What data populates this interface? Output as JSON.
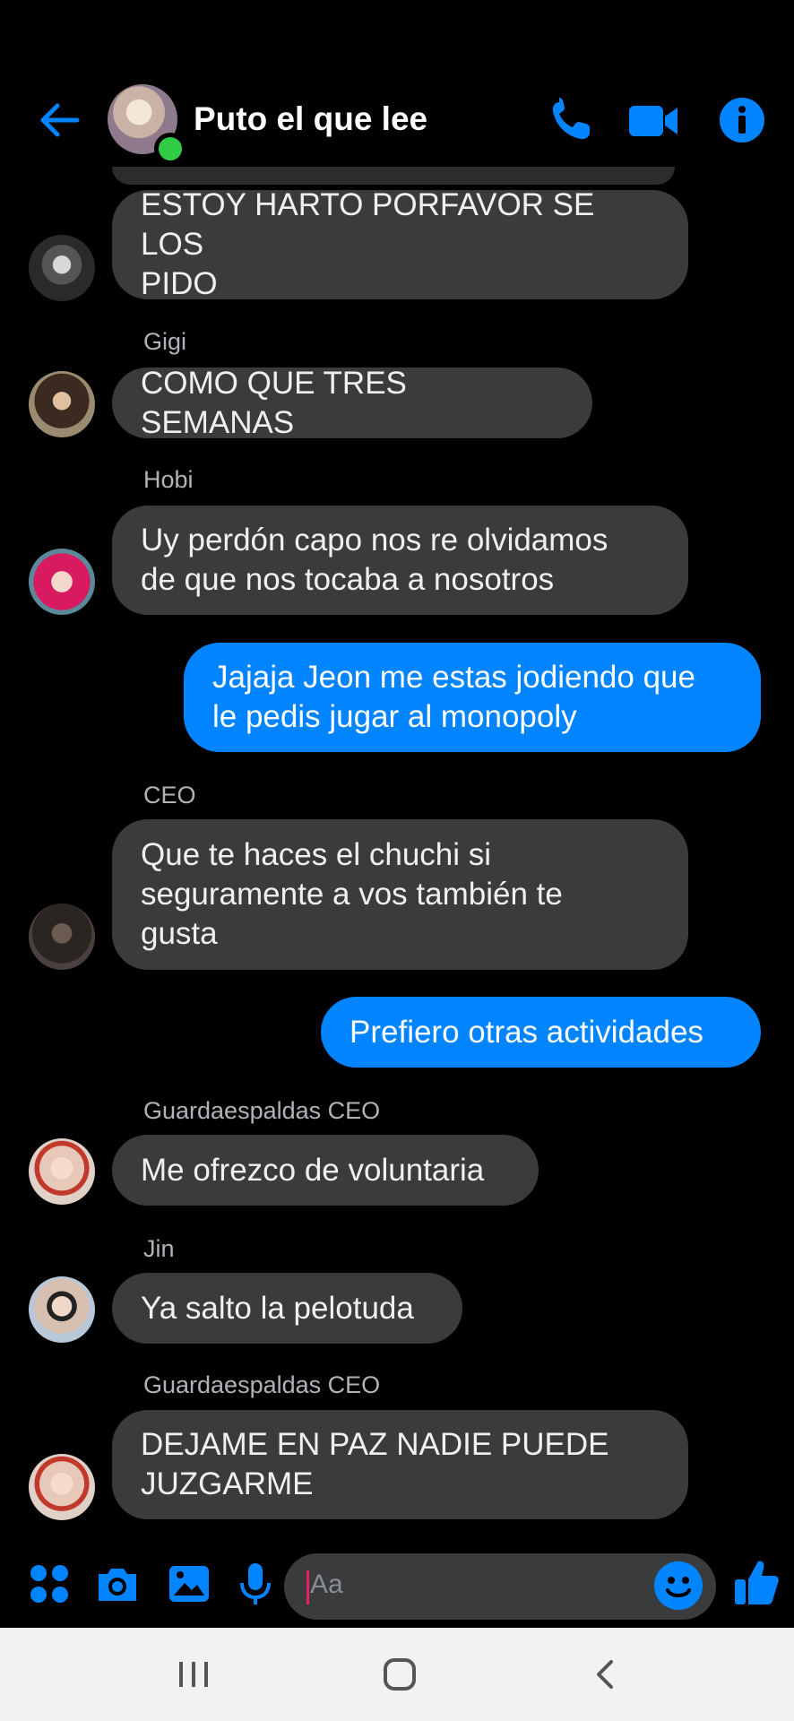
{
  "header": {
    "title": "Puto el que lee",
    "back_icon": "arrow-left-icon",
    "call_icon": "phone-icon",
    "video_icon": "video-camera-icon",
    "info_icon": "info-icon",
    "accent_color": "#0084ff",
    "online_color": "#31cc46"
  },
  "messages": [
    {
      "sender": "",
      "text_lines": [
        "ESTOY HARTO PORFAVOR SE LOS",
        "PIDO"
      ],
      "outgoing": false
    },
    {
      "sender": "Gigi",
      "text_lines": [
        "COMO QUE TRES SEMANAS"
      ],
      "outgoing": false
    },
    {
      "sender": "Hobi",
      "text_lines": [
        "Uy perdón capo nos re olvidamos",
        "de que nos tocaba a nosotros"
      ],
      "outgoing": false
    },
    {
      "sender": "",
      "text_lines": [
        "Jajaja Jeon me estas jodiendo que",
        "le pedis jugar al monopoly"
      ],
      "outgoing": true
    },
    {
      "sender": "CEO",
      "text_lines": [
        "Que te haces el chuchi si",
        "seguramente a vos también te",
        "gusta"
      ],
      "outgoing": false
    },
    {
      "sender": "",
      "text_lines": [
        "Prefiero otras actividades"
      ],
      "outgoing": true
    },
    {
      "sender": "Guardaespaldas CEO",
      "text_lines": [
        "Me ofrezco de voluntaria"
      ],
      "outgoing": false
    },
    {
      "sender": "Jin",
      "text_lines": [
        "Ya salto la pelotuda"
      ],
      "outgoing": false
    },
    {
      "sender": "Guardaespaldas CEO",
      "text_lines": [
        "DEJAME EN PAZ NADIE PUEDE",
        "JUZGARME"
      ],
      "outgoing": false
    }
  ],
  "composer": {
    "placeholder": "Aa",
    "icons": [
      "menu-dots-icon",
      "camera-icon",
      "gallery-icon",
      "microphone-icon",
      "emoji-icon",
      "thumbs-up-icon"
    ]
  },
  "navbar": {
    "icons": [
      "recent-apps-icon",
      "home-icon",
      "back-icon"
    ]
  },
  "colors": {
    "background": "#000000",
    "incoming_bubble": "#3a3b3c",
    "outgoing_bubble": "#0084ff"
  }
}
